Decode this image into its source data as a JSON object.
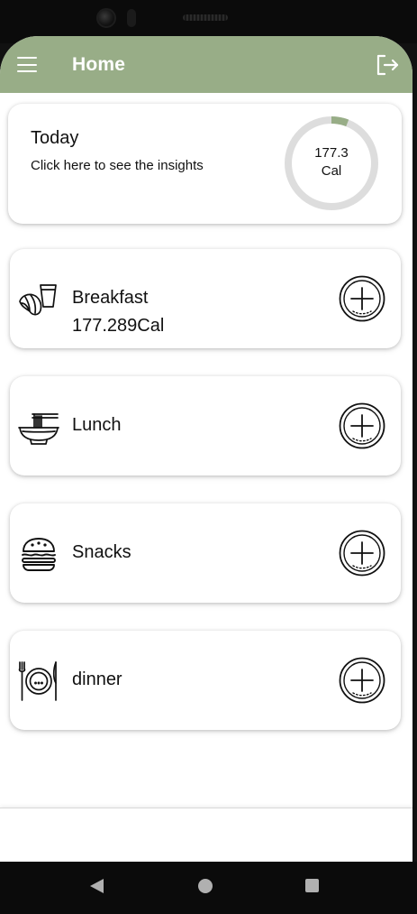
{
  "appbar": {
    "title": "Home",
    "color": "#98ad87",
    "menu_icon": "hamburger-menu-icon",
    "logout_icon": "logout-icon"
  },
  "today": {
    "title": "Today",
    "subtitle": "Click here to see the insights",
    "calories_value": "177.3",
    "calories_unit": "Cal",
    "progress_fraction": 0.06,
    "ring_track_color": "#dddddd",
    "ring_progress_color": "#98ad87"
  },
  "meals": [
    {
      "name": "Breakfast",
      "calories": "177.289Cal",
      "icon": "croissant-coffee-icon",
      "add_icon": "add-plate-icon"
    },
    {
      "name": "Lunch",
      "calories": "",
      "icon": "noodle-bowl-icon",
      "add_icon": "add-plate-icon"
    },
    {
      "name": "Snacks",
      "calories": "",
      "icon": "burger-icon",
      "add_icon": "add-plate-icon"
    },
    {
      "name": "dinner",
      "calories": "",
      "icon": "plate-cutlery-icon",
      "add_icon": "add-plate-icon"
    }
  ],
  "system_nav": {
    "back_icon": "triangle-back-icon",
    "home_icon": "circle-home-icon",
    "recents_icon": "square-recents-icon"
  }
}
